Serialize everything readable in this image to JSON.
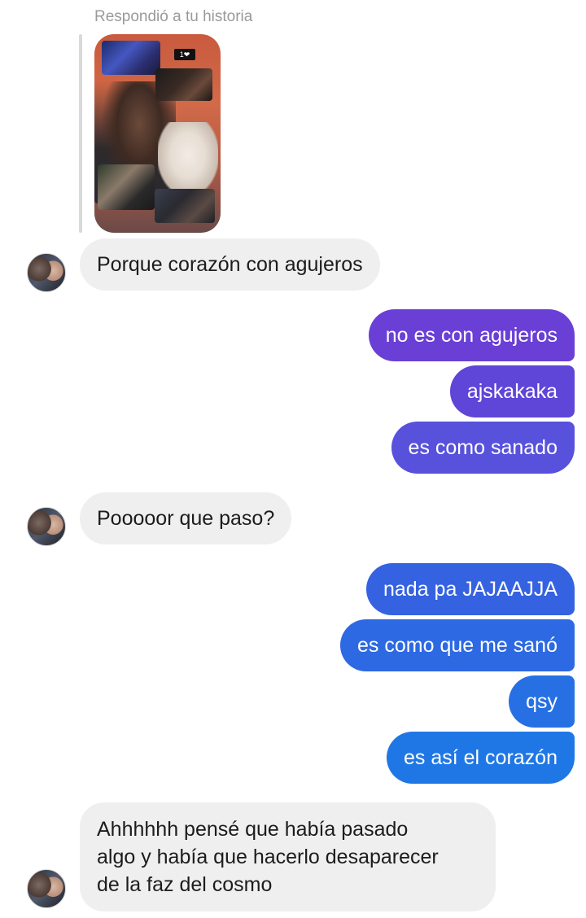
{
  "story_reply": {
    "header": "Respondió a tu historia",
    "sticker": "1❤"
  },
  "messages": [
    {
      "side": "in",
      "text": "Porque corazón con agujeros"
    },
    {
      "side": "out",
      "text": "no es con agujeros"
    },
    {
      "side": "out",
      "text": "ajskakaka"
    },
    {
      "side": "out",
      "text": "es como sanado"
    },
    {
      "side": "in",
      "text": "Pooooor que paso?"
    },
    {
      "side": "out",
      "text": "nada pa JAJAAJJA"
    },
    {
      "side": "out",
      "text": "es como que me sanó"
    },
    {
      "side": "out",
      "text": "qsy"
    },
    {
      "side": "out",
      "text": "es así el corazón"
    },
    {
      "side": "in",
      "lines": [
        "Ahhhhhh pensé que había pasado",
        "algo y había que hacerlo desaparecer",
        "de la faz del cosmo"
      ]
    }
  ],
  "colors": {
    "incoming_bubble": "#efefef",
    "outgoing_gradient_top": "#6a3fd6",
    "outgoing_gradient_bottom": "#1d78e8",
    "header_text": "#9a9a9a"
  },
  "icons": {
    "avatar": "contact-avatar"
  }
}
